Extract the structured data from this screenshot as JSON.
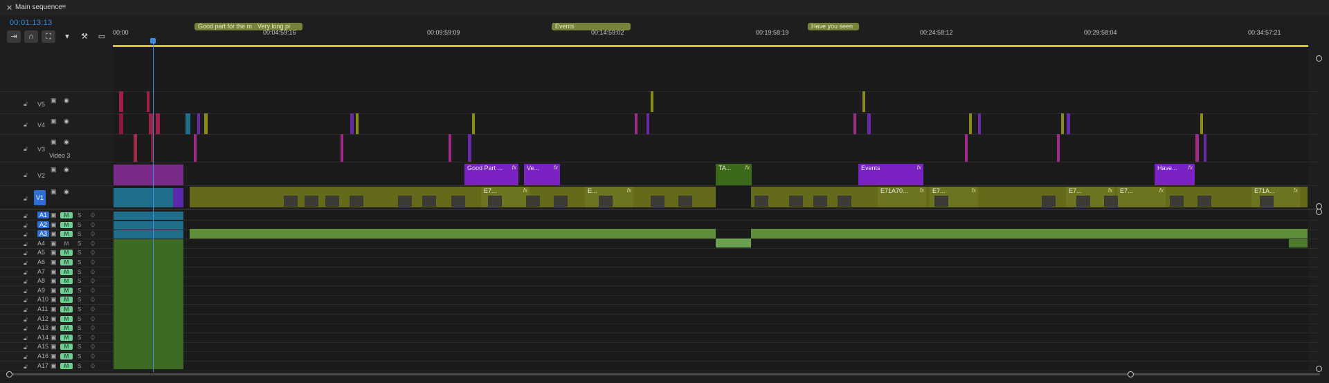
{
  "panel": {
    "title": "Main sequence",
    "timecode": "00:01:13:13"
  },
  "toolbar": {
    "icons": [
      "insert-icon",
      "snap-icon",
      "linked-select-icon",
      "marker-icon",
      "wrench-icon",
      "captions-icon"
    ]
  },
  "ruler": {
    "ticks": [
      "00:00",
      "00:04:59:16",
      "00:09:59:09",
      "00:14:59:02",
      "00:19:58:19",
      "00:24:58:12",
      "00:29:58:04",
      "00:34:57:21"
    ]
  },
  "markers": [
    "Good part for the m",
    "Very long pi",
    "Events",
    "Have you seen"
  ],
  "video_tracks": [
    {
      "name": "V5",
      "label": ""
    },
    {
      "name": "V4",
      "label": ""
    },
    {
      "name": "V3",
      "label": "Video 3"
    },
    {
      "name": "V2",
      "label": ""
    },
    {
      "name": "V1",
      "label": ""
    }
  ],
  "audio_tracks": [
    "A1",
    "A2",
    "A3",
    "A4",
    "A5",
    "A6",
    "A7",
    "A8",
    "A9",
    "A10",
    "A11",
    "A12",
    "A13",
    "A14",
    "A15",
    "A16",
    "A17"
  ],
  "audio_buttons": {
    "mute": "M",
    "solo": "S"
  },
  "clips": {
    "v2": [
      "Good Part ...",
      "Ve...",
      "TA...",
      "Events",
      "Have..."
    ],
    "v1": [
      "E7...",
      "E...",
      "E71A70...",
      "E7...",
      "E7...",
      "E7...",
      "E71A..."
    ],
    "fx": "fx"
  },
  "colors": {
    "accent": "#2d8ceb",
    "video_clip": "#646a1a",
    "purple_clip": "#7a22c4",
    "audio_clip": "#5f8f3a",
    "marker": "#77833a",
    "work_area": "#cfc32a"
  }
}
